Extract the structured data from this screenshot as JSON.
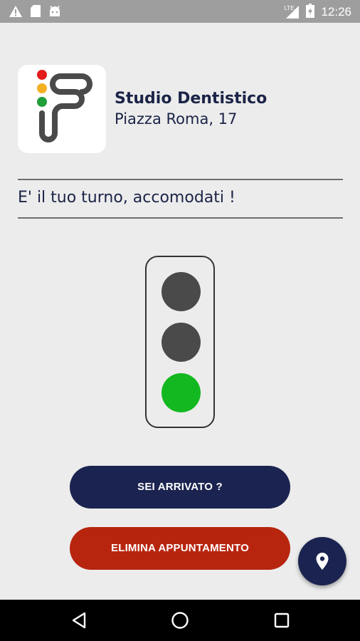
{
  "status_bar": {
    "time": "12:26",
    "network_label": "LTE",
    "icons": [
      "warning-icon",
      "sd-card-icon",
      "android-icon",
      "signal-icon",
      "battery-icon"
    ]
  },
  "place": {
    "name": "Studio Dentistico",
    "address": "Piazza Roma, 17",
    "logo_icon": "traffic-queue-logo"
  },
  "status_message": "E' il tuo turno, accomodati !",
  "traffic_light": {
    "active": "green",
    "lamps": [
      {
        "state": "off",
        "color": "#4a4a4a"
      },
      {
        "state": "off",
        "color": "#4a4a4a"
      },
      {
        "state": "on",
        "color": "#13b820"
      }
    ]
  },
  "buttons": {
    "arrived_label": "SEI ARRIVATO ?",
    "delete_label": "ELIMINA APPUNTAMENTO"
  },
  "fab": {
    "icon": "location-pin-icon"
  },
  "nav_bar": {
    "icons": [
      "back-icon",
      "home-icon",
      "recents-icon"
    ]
  },
  "colors": {
    "primary": "#1b2450",
    "danger": "#b8250f",
    "light_on": "#13b820",
    "light_off": "#4a4a4a",
    "background": "#ececec"
  }
}
